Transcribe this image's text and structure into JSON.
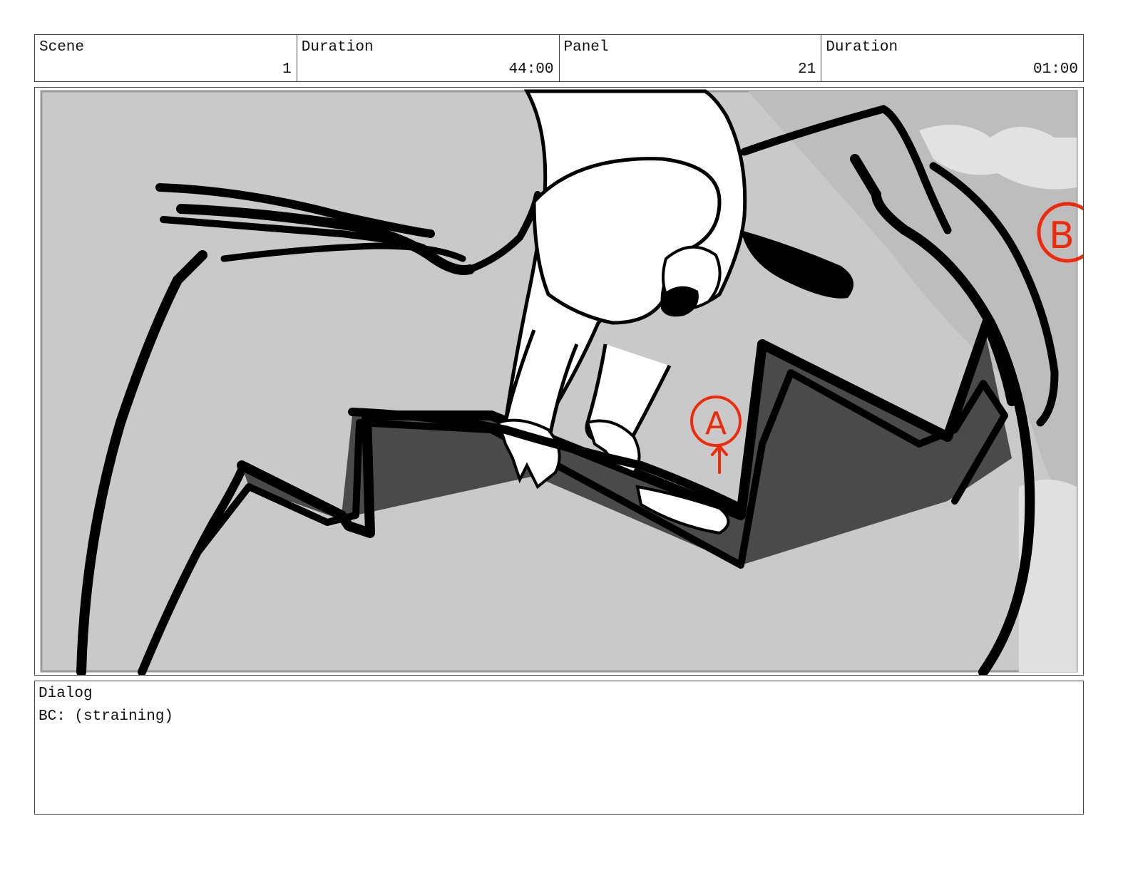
{
  "header": {
    "scene_label": "Scene",
    "scene_value": "1",
    "scene_duration_label": "Duration",
    "scene_duration_value": "44:00",
    "panel_label": "Panel",
    "panel_value": "21",
    "panel_duration_label": "Duration",
    "panel_duration_value": "01:00"
  },
  "panel": {
    "markers": {
      "a": "A",
      "b": "B"
    },
    "colors": {
      "background": "#c9c9c9",
      "ink": "#000000",
      "annotation": "#ee2a0c",
      "shadow": "#4a4a4a"
    }
  },
  "dialog": {
    "label": "Dialog",
    "text": "BC: (straining)"
  }
}
